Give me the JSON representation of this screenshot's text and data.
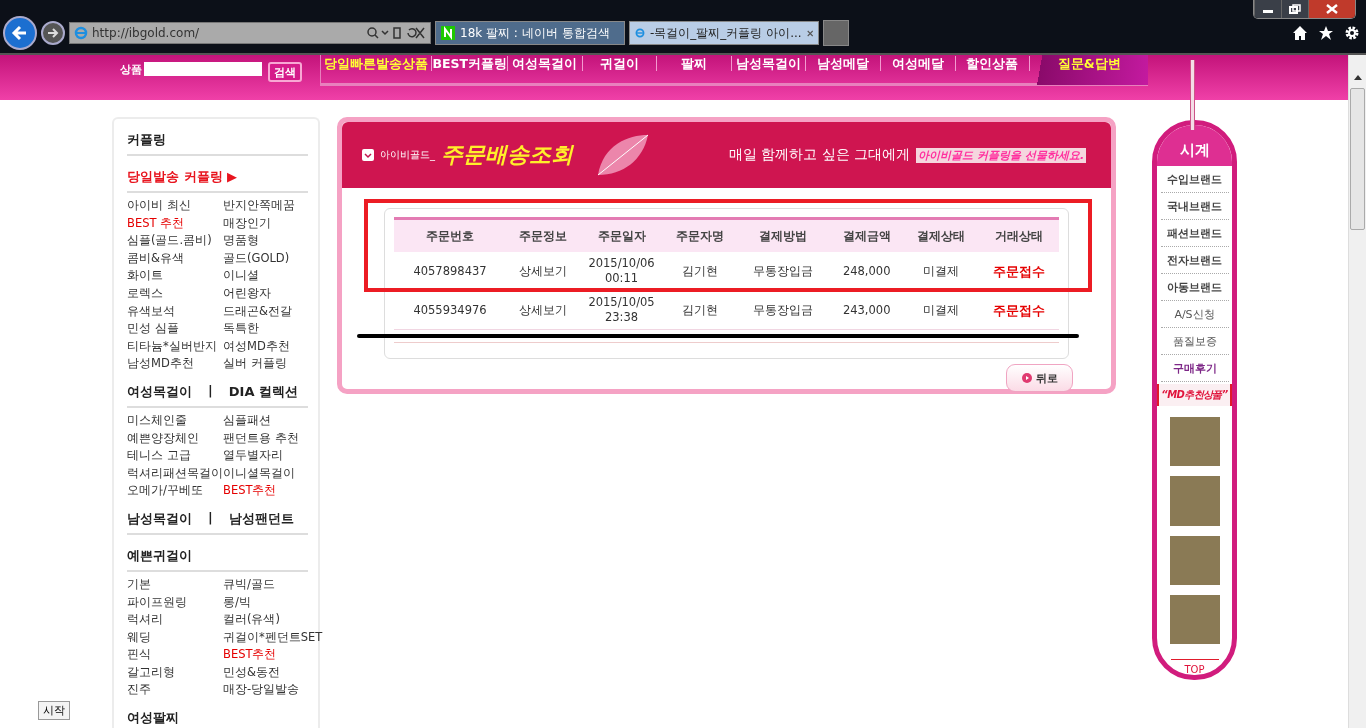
{
  "browser": {
    "address": "http://ibgold.com/",
    "tabs": [
      {
        "label": "18k 팔찌 : 네이버 통합검색",
        "kind": "naver",
        "selected": false
      },
      {
        "label": "-목걸이_팔찌_커플링 아이...",
        "kind": "ie",
        "selected": true
      }
    ]
  },
  "site": {
    "search": {
      "label": "상품",
      "button": "검색"
    },
    "nav": [
      {
        "label": "당일빠른발송상품",
        "kind": "featured"
      },
      {
        "label": "BEST커플링",
        "kind": "normal"
      },
      {
        "label": "여성목걸이",
        "kind": "normal"
      },
      {
        "label": "귀걸이",
        "kind": "normal"
      },
      {
        "label": "팔찌",
        "kind": "normal"
      },
      {
        "label": "남성목걸이",
        "kind": "normal"
      },
      {
        "label": "남성메달",
        "kind": "normal"
      },
      {
        "label": "여성메달",
        "kind": "normal"
      },
      {
        "label": "할인상품",
        "kind": "normal"
      },
      {
        "label": "질문&답변",
        "kind": "special"
      }
    ]
  },
  "sidebar": [
    {
      "kind": "heading",
      "parts": [
        "커플링"
      ]
    },
    {
      "kind": "promo",
      "parts": [
        "당일발송 커플링 ▶"
      ]
    },
    {
      "kind": "links",
      "items": [
        {
          "label": "아이비 최신",
          "highlight": false
        },
        {
          "label": "반지안쪽메꿈",
          "highlight": false
        },
        {
          "label": "BEST 추천",
          "highlight": true
        },
        {
          "label": "매장인기",
          "highlight": false
        },
        {
          "label": "심플(골드.콤비)",
          "highlight": false
        },
        {
          "label": "명품형",
          "highlight": false
        },
        {
          "label": "콤비&유색",
          "highlight": false
        },
        {
          "label": "골드(GOLD)",
          "highlight": false
        },
        {
          "label": "화이트",
          "highlight": false
        },
        {
          "label": "이니셜",
          "highlight": false
        },
        {
          "label": "로렉스",
          "highlight": false
        },
        {
          "label": "어린왕자",
          "highlight": false
        },
        {
          "label": "유색보석",
          "highlight": false
        },
        {
          "label": "드래곤&전갈",
          "highlight": false
        },
        {
          "label": "민성 심플",
          "highlight": false
        },
        {
          "label": "독특한",
          "highlight": false
        },
        {
          "label": "티타늄*실버반지",
          "highlight": false
        },
        {
          "label": "여성MD추천",
          "highlight": false
        },
        {
          "label": "남성MD추천",
          "highlight": false
        },
        {
          "label": "실버 커플링",
          "highlight": false
        }
      ]
    },
    {
      "kind": "heading",
      "parts": [
        "여성목걸이",
        "|",
        "DIA 컬렉션"
      ]
    },
    {
      "kind": "links",
      "items": [
        {
          "label": "미스체인줄",
          "highlight": false
        },
        {
          "label": "심플패션",
          "highlight": false
        },
        {
          "label": "예쁜양장체인",
          "highlight": false
        },
        {
          "label": "팬던트용 추천",
          "highlight": false
        },
        {
          "label": "테니스 고급",
          "highlight": false
        },
        {
          "label": "열두별자리",
          "highlight": false
        },
        {
          "label": "럭셔리패션목걸이",
          "highlight": false
        },
        {
          "label": "이니셜목걸이",
          "highlight": false
        },
        {
          "label": "오메가/꾸베또",
          "highlight": false
        },
        {
          "label": "BEST추천",
          "highlight": true
        }
      ]
    },
    {
      "kind": "heading",
      "parts": [
        "남성목걸이",
        "|",
        "남성팬던트"
      ]
    },
    {
      "kind": "heading",
      "parts": [
        "예쁜귀걸이"
      ]
    },
    {
      "kind": "links",
      "items": [
        {
          "label": "기본",
          "highlight": false
        },
        {
          "label": "큐빅/골드",
          "highlight": false
        },
        {
          "label": "파이프원링",
          "highlight": false
        },
        {
          "label": "롱/빅",
          "highlight": false
        },
        {
          "label": "럭셔리",
          "highlight": false
        },
        {
          "label": "컬러(유색)",
          "highlight": false
        },
        {
          "label": "웨딩",
          "highlight": false
        },
        {
          "label": "귀걸이*펜던트SET",
          "highlight": false
        },
        {
          "label": "핀식",
          "highlight": false
        },
        {
          "label": "BEST추천",
          "highlight": true
        },
        {
          "label": "갈고리형",
          "highlight": false
        },
        {
          "label": "민성&동전",
          "highlight": false
        },
        {
          "label": "진주",
          "highlight": false
        },
        {
          "label": "매장-당일발송",
          "highlight": false
        }
      ]
    },
    {
      "kind": "heading",
      "parts": [
        "여성팔찌"
      ]
    }
  ],
  "panel": {
    "brand": "아이비골드_",
    "title": "주문배송조회",
    "slogan": "매일 함께하고 싶은 그대에게",
    "slogan_script": "아이비골드 커플링을 선물하세요.",
    "table": {
      "columns": [
        "주문번호",
        "주문정보",
        "주문일자",
        "주문자명",
        "결제방법",
        "결제금액",
        "결제상태",
        "거래상태"
      ],
      "rows": [
        [
          "4057898437",
          "상세보기",
          "2015/10/06\n00:11",
          "김기현",
          "무통장입금",
          "248,000",
          "미결제",
          "주문접수"
        ],
        [
          "4055934976",
          "상세보기",
          "2015/10/05\n23:38",
          "김기현",
          "무통장입금",
          "243,000",
          "미결제",
          "주문접수"
        ]
      ]
    },
    "back_button": "뒤로"
  },
  "widget": {
    "title": "시계",
    "items": [
      {
        "label": "**수입**브랜드",
        "kind": "brand"
      },
      {
        "label": "**국내**브랜드",
        "kind": "brand"
      },
      {
        "label": "**패션**브랜드",
        "kind": "brand"
      },
      {
        "label": "**전자**브랜드",
        "kind": "brand"
      },
      {
        "label": "**아동**브랜드",
        "kind": "brand"
      },
      {
        "label": "A/S신청",
        "kind": "plain"
      },
      {
        "label": "품질보증",
        "kind": "plain"
      },
      {
        "label": "구매후기",
        "kind": "review"
      }
    ],
    "banner": "“MD추천상품”",
    "top": "TOP"
  },
  "start_button": "시작"
}
